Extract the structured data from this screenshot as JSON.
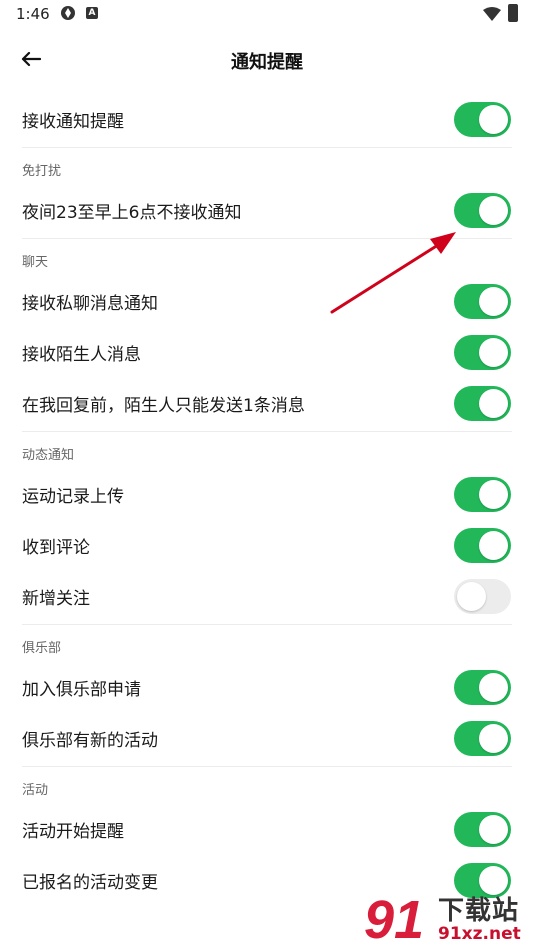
{
  "status_bar": {
    "time": "1:46",
    "badge": "A"
  },
  "header": {
    "title": "通知提醒"
  },
  "sections": [
    {
      "header": "",
      "items": [
        {
          "label": "接收通知提醒",
          "on": true
        }
      ]
    },
    {
      "header": "免打扰",
      "items": [
        {
          "label": "夜间23至早上6点不接收通知",
          "on": true
        }
      ]
    },
    {
      "header": "聊天",
      "items": [
        {
          "label": "接收私聊消息通知",
          "on": true
        },
        {
          "label": "接收陌生人消息",
          "on": true
        },
        {
          "label": "在我回复前，陌生人只能发送1条消息",
          "on": true
        }
      ]
    },
    {
      "header": "动态通知",
      "items": [
        {
          "label": "运动记录上传",
          "on": true
        },
        {
          "label": "收到评论",
          "on": true
        },
        {
          "label": "新增关注",
          "on": false
        }
      ]
    },
    {
      "header": "俱乐部",
      "items": [
        {
          "label": "加入俱乐部申请",
          "on": true
        },
        {
          "label": "俱乐部有新的活动",
          "on": true
        }
      ]
    },
    {
      "header": "活动",
      "items": [
        {
          "label": "活动开始提醒",
          "on": true
        },
        {
          "label": "已报名的活动变更",
          "on": true
        }
      ]
    }
  ],
  "watermark": {
    "text": "下载站",
    "url": "91xz.net"
  },
  "colors": {
    "toggle_on": "#22b85a",
    "toggle_off": "#ececec",
    "arrow": "#d0021b"
  },
  "icons": {
    "back": "arrow-left-icon"
  }
}
